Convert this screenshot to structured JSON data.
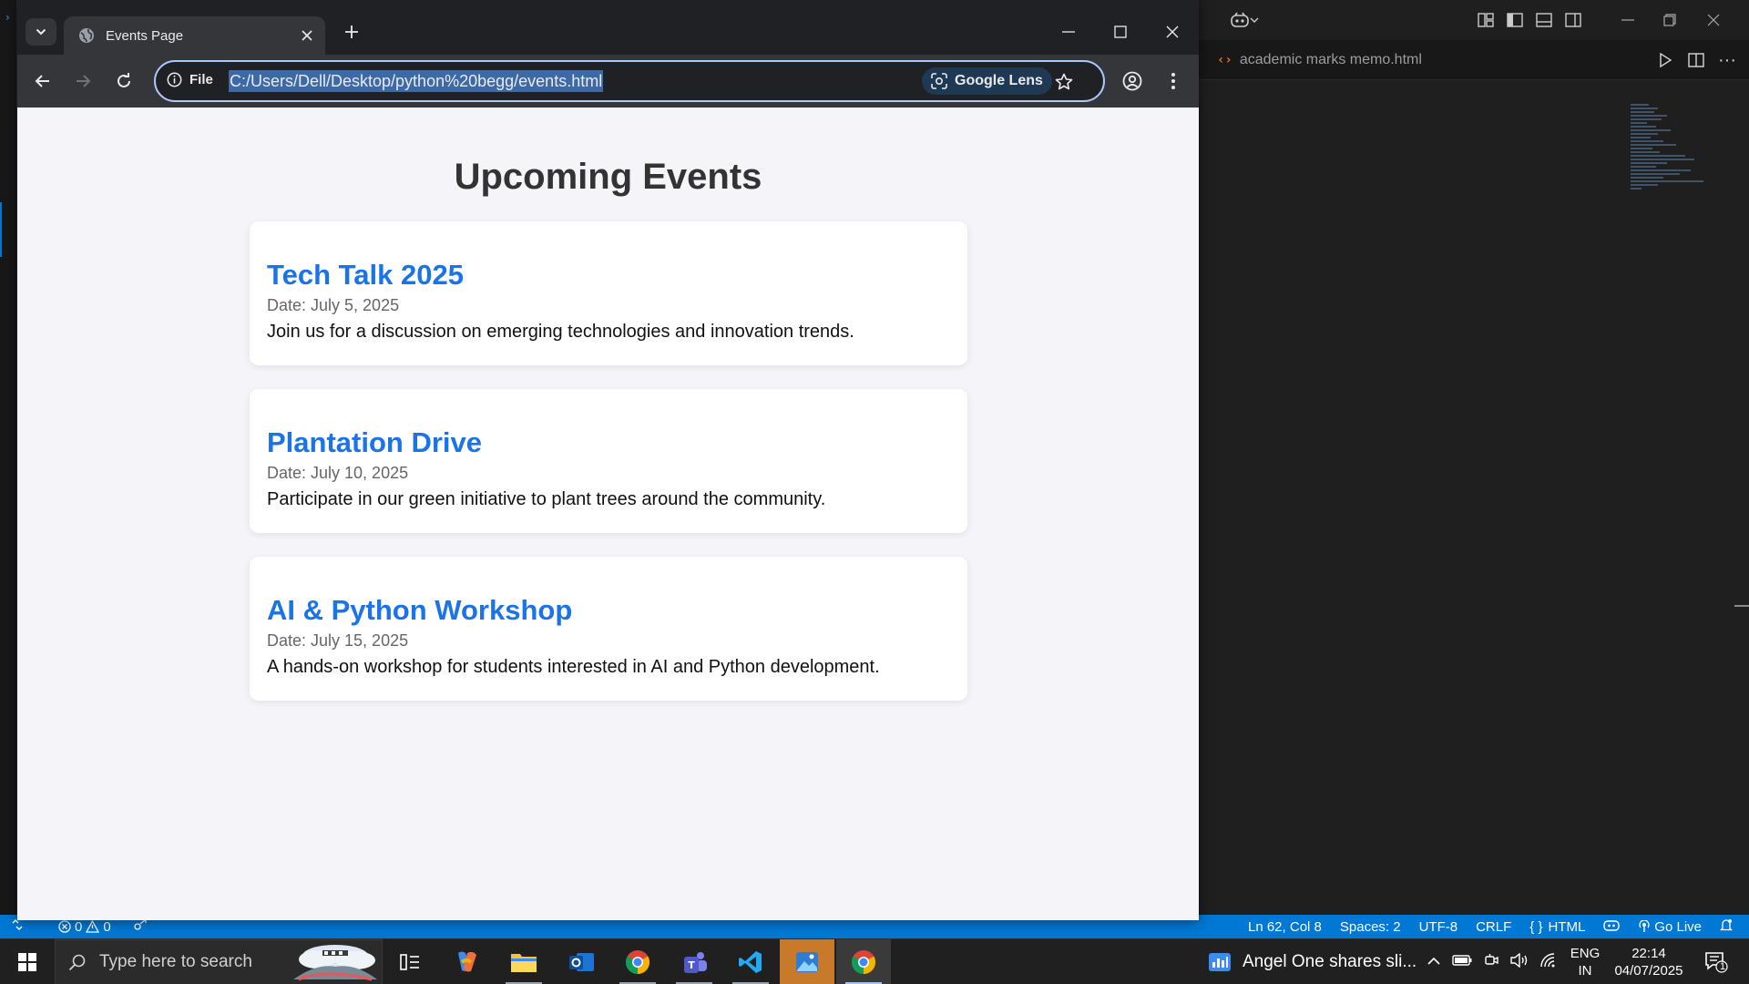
{
  "browser": {
    "tab_title": "Events Page",
    "url_scheme_label": "File",
    "url": "C:/Users/Dell/Desktop/python%20begg/events.html",
    "lens_label": "Google Lens"
  },
  "page": {
    "heading": "Upcoming Events",
    "events": [
      {
        "title": "Tech Talk 2025",
        "date": "Date: July 5, 2025",
        "description": "Join us for a discussion on emerging technologies and innovation trends."
      },
      {
        "title": "Plantation Drive",
        "date": "Date: July 10, 2025",
        "description": "Participate in our green initiative to plant trees around the community."
      },
      {
        "title": "AI & Python Workshop",
        "date": "Date: July 15, 2025",
        "description": "A hands-on workshop for students interested in AI and Python development."
      }
    ]
  },
  "vscode": {
    "tab_label": "academic marks memo.html",
    "status": {
      "errors": "0",
      "warnings": "0",
      "position": "Ln 62, Col 8",
      "spaces": "Spaces: 2",
      "encoding": "UTF-8",
      "eol": "CRLF",
      "language": "HTML",
      "go_live": "Go Live"
    }
  },
  "taskbar": {
    "search_placeholder": "Type here to search",
    "news_text": "Angel One shares sli...",
    "lang_line1": "ENG",
    "lang_line2": "IN",
    "time": "22:14",
    "date": "04/07/2025",
    "notification_count": "1"
  },
  "colors": {
    "link_blue": "#1a73e8",
    "vscode_status_blue": "#0078d4",
    "page_background": "#f4f4f9"
  }
}
